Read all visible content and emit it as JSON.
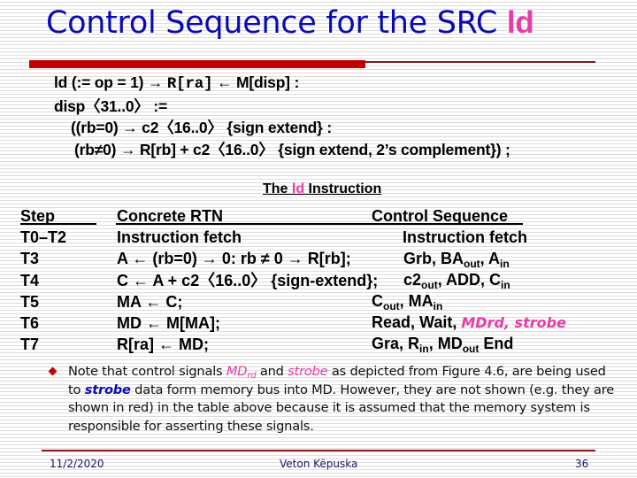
{
  "slide": {
    "title_prefix": "Control Sequence for the SRC ",
    "title_highlight": "ld",
    "colors": {
      "title": "#0a0ab4",
      "highlight": "#e63ca6",
      "accent_bar": "#c00000",
      "footer_text": "#1a1a6e"
    }
  },
  "rtn": {
    "line1_a": "ld (:= op = 1) → ",
    "line1_reg": "R[ra]",
    "line1_b": " ← M[disp] :",
    "line2": "disp〈31..0〉 :=",
    "line3": "((rb=0) → c2〈16..0〉 {sign extend} :",
    "line4": "(rb≠0) → R[rb] + c2〈16..0〉 {sign extend, 2’s complement}) ;"
  },
  "caption": {
    "prefix": "The ",
    "highlight": "ld",
    "suffix": " Instruction"
  },
  "table": {
    "headers": {
      "step": "Step",
      "rtn": "Concrete RTN",
      "control": "Control Sequence"
    },
    "rows": [
      {
        "step": "T0–T2",
        "rtn": "Instruction fetch",
        "control": "Instruction fetch"
      },
      {
        "step": "T3",
        "rtn": "A ← (rb=0) → 0: rb ≠  0 → R[rb];",
        "control_parts": [
          "Grb, BA",
          "out",
          ", A",
          "in"
        ]
      },
      {
        "step": "T4",
        "rtn": "C ← A +  c2〈16..0〉 {sign-extend};",
        "control_parts": [
          "c2",
          "out",
          ", ADD, C",
          "in"
        ]
      },
      {
        "step": "T5",
        "rtn": "MA ← C;",
        "control_parts": [
          "C",
          "out",
          ", MA",
          "in"
        ]
      },
      {
        "step": "T6",
        "rtn": "MD ← M[MA];",
        "control_plain": "Read, Wait, ",
        "control_highlight": "MDrd, strobe"
      },
      {
        "step": "T7",
        "rtn": "R[ra] ← MD;",
        "control_parts": [
          "Gra, R",
          "in",
          ", MD",
          "out",
          " End"
        ]
      }
    ]
  },
  "note": {
    "t1": "Note that control signals ",
    "md": "MD",
    "rd": "rd",
    "t2": " and ",
    "strobe1": "strobe",
    "t3": " as depicted from Figure 4.6, are being used to ",
    "strobe2": "strobe",
    "t4": " data form memory bus into MD. However, they are not shown (e.g. they are shown in red) in the table above because it is assumed that the memory system is responsible for asserting these signals."
  },
  "footer": {
    "date": "11/2/2020",
    "author": "Veton Këpuska",
    "page": "36"
  }
}
